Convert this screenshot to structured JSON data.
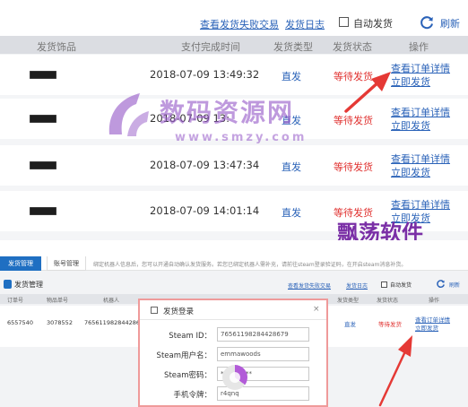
{
  "top_panel": {
    "toolbar": {
      "failed_orders_link": "查看发货失败交易",
      "delivery_log_link": "发货日志",
      "auto_send_label": "自动发货",
      "auto_send_checked": false,
      "refresh_label": "刷新"
    },
    "columns": [
      "发货饰品",
      "支付完成时间",
      "发货类型",
      "发货状态",
      "操作"
    ],
    "rows": [
      {
        "time": "2018-07-09 13:49:32",
        "type": "直发",
        "status": "等待发货",
        "detail_link": "查看订单详情",
        "send_link": "立即发货"
      },
      {
        "time": "2018-07-09 13:",
        "type": "直发",
        "status": "等待发货",
        "detail_link": "查看订单详情",
        "send_link": "立即发货"
      },
      {
        "time": "2018-07-09 13:47:34",
        "type": "直发",
        "status": "等待发货",
        "detail_link": "查看订单详情",
        "send_link": "立即发货"
      },
      {
        "time": "2018-07-09 14:01:14",
        "type": "直发",
        "status": "等待发货",
        "detail_link": "查看订单详情",
        "send_link": "立即发货"
      }
    ],
    "watermark_text": "数码资源网",
    "watermark_url": "www.smzy.com",
    "watermark_brand": "飘荡软件"
  },
  "bottom_panel": {
    "tabs": [
      "发货管理",
      "账号管理"
    ],
    "notice": "绑定机器人信息后，您可以开通自动确认发货服务。若您已绑定机器人需补充，请前往steam登录验证码，在开启steam消息补货。",
    "title": "发货管理",
    "failed_orders_link": "查看发货失败交易",
    "delivery_log_link": "发货日志",
    "auto_send_label": "自动发货",
    "refresh_label": "刷新",
    "columns": [
      "订单号",
      "物品单号",
      "机器人",
      "发货类型",
      "发货状态",
      "操作"
    ],
    "row": {
      "order_no": "6557540",
      "item_no": "3078552",
      "robot": "76561198284428679",
      "type": "直发",
      "status": "等待发货",
      "detail_link": "查看订单详情",
      "send_link": "立即发货"
    },
    "dialog": {
      "title": "发货登录",
      "close": "×",
      "steam_id_label": "Steam ID：",
      "steam_id_value": "76561198284428679",
      "username_label": "Steam用户名：",
      "username_value": "emmawoods",
      "password_label": "Steam密码：",
      "password_value": "**********",
      "token_label": "手机令牌：",
      "token_value": "r4qnq"
    }
  },
  "colors": {
    "link": "#2a62b8",
    "status_red": "#e0312f",
    "arrow_red": "#e53935",
    "tab_active": "#1f6fc2",
    "watermark_purple": "#7a2fa6"
  }
}
